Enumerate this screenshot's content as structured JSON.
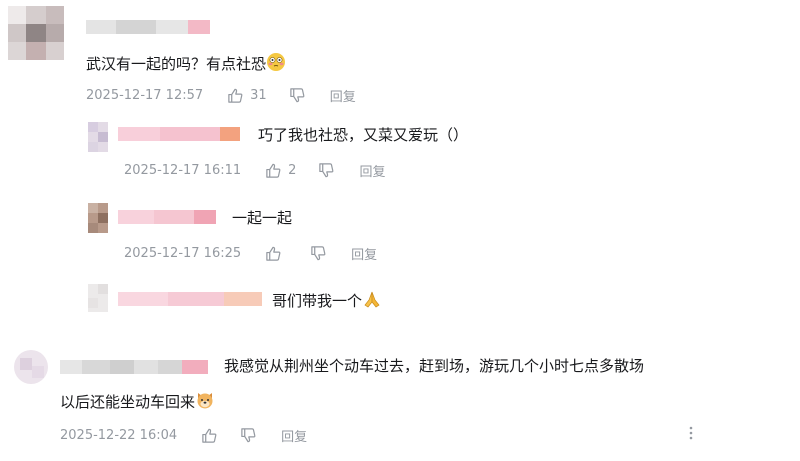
{
  "comments": [
    {
      "text": "武汉有一起的吗？有点社恐",
      "emoji": "flushed-face-emoji",
      "time": "2025-12-17 12:57",
      "likes": "31",
      "reply_label": "回复",
      "replies": [
        {
          "text": "巧了我也社恐，又菜又爱玩（）",
          "time": "2025-12-17 16:11",
          "likes": "2",
          "reply_label": "回复"
        },
        {
          "text": "一起一起",
          "time": "2025-12-17 16:25",
          "likes": "",
          "reply_label": "回复"
        },
        {
          "text": "哥们带我一个",
          "emoji": "folded-hands-emoji"
        }
      ]
    },
    {
      "text_line1": "我感觉从荆州坐个动车过去，赶到场，游玩几个小时七点多散场",
      "text_line2": "以后还能坐动车回来",
      "emoji": "dog-face-emoji",
      "time": "2025-12-22 16:04",
      "reply_label": "回复"
    }
  ],
  "colors": {
    "text": "#18191c",
    "meta": "#9499a0",
    "pink_blur": "#f6c9d4",
    "blur_gray": "#d9d9d9"
  },
  "icons": [
    "thumb-up-icon",
    "thumb-down-icon",
    "more-vertical-icon"
  ]
}
